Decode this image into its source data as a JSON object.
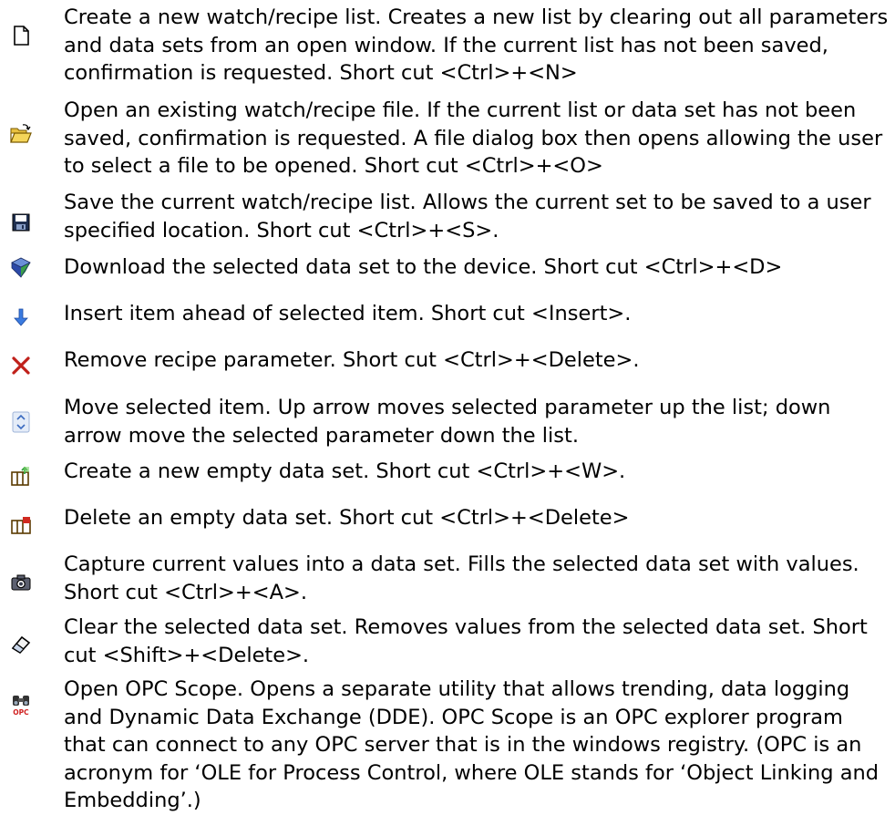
{
  "entries": [
    {
      "icon": "new-document-icon",
      "text": "Create a new watch/recipe list. Creates a new list by clearing out all parameters and data sets from an open window. If the current list has not been saved, confirmation is requested. Short cut <Ctrl>+<N>"
    },
    {
      "icon": "open-folder-icon",
      "text": "Open an existing watch/recipe file. If the current list or data set has not been saved, confirmation is requested. A file dialog box then opens allowing the user to select a file to be opened. Short cut <Ctrl>+<O>"
    },
    {
      "icon": "save-disk-icon",
      "text": "Save the current watch/recipe list. Allows the current set to be saved to a user specified location. Short cut <Ctrl>+<S>."
    },
    {
      "icon": "download-icon",
      "text": "Download the selected data set to the device. Short cut <Ctrl>+<D>"
    },
    {
      "icon": "insert-arrow-icon",
      "text": "Insert item ahead of selected item. Short cut <Insert>."
    },
    {
      "icon": "remove-x-icon",
      "text": "Remove recipe parameter. Short cut <Ctrl>+<Delete>."
    },
    {
      "icon": "move-updown-icon",
      "text": "Move selected item. Up arrow moves selected parameter up the list; down arrow move the selected parameter down the list."
    },
    {
      "icon": "new-dataset-icon",
      "text": "Create a new empty data set. Short cut <Ctrl>+<W>."
    },
    {
      "icon": "delete-dataset-icon",
      "text": "Delete an empty data set. Short cut <Ctrl>+<Delete>"
    },
    {
      "icon": "capture-camera-icon",
      "text": "Capture current values into a data set. Fills the selected data set with values. Short cut <Ctrl>+<A>."
    },
    {
      "icon": "eraser-icon",
      "text": "Clear the selected data set. Removes values from the selected data set. Short cut <Shift>+<Delete>."
    },
    {
      "icon": "opc-scope-icon",
      "text": "Open OPC Scope. Opens a separate utility that allows trending, data logging and Dynamic Data Exchange (DDE). OPC Scope is an OPC explorer program that can connect to any OPC server that is in the windows registry. (OPC is an acronym for ‘OLE for Process Control, where OLE stands for ‘Object Linking and Embedding’.)"
    }
  ],
  "icon_labels": {
    "opc": "OPC"
  }
}
